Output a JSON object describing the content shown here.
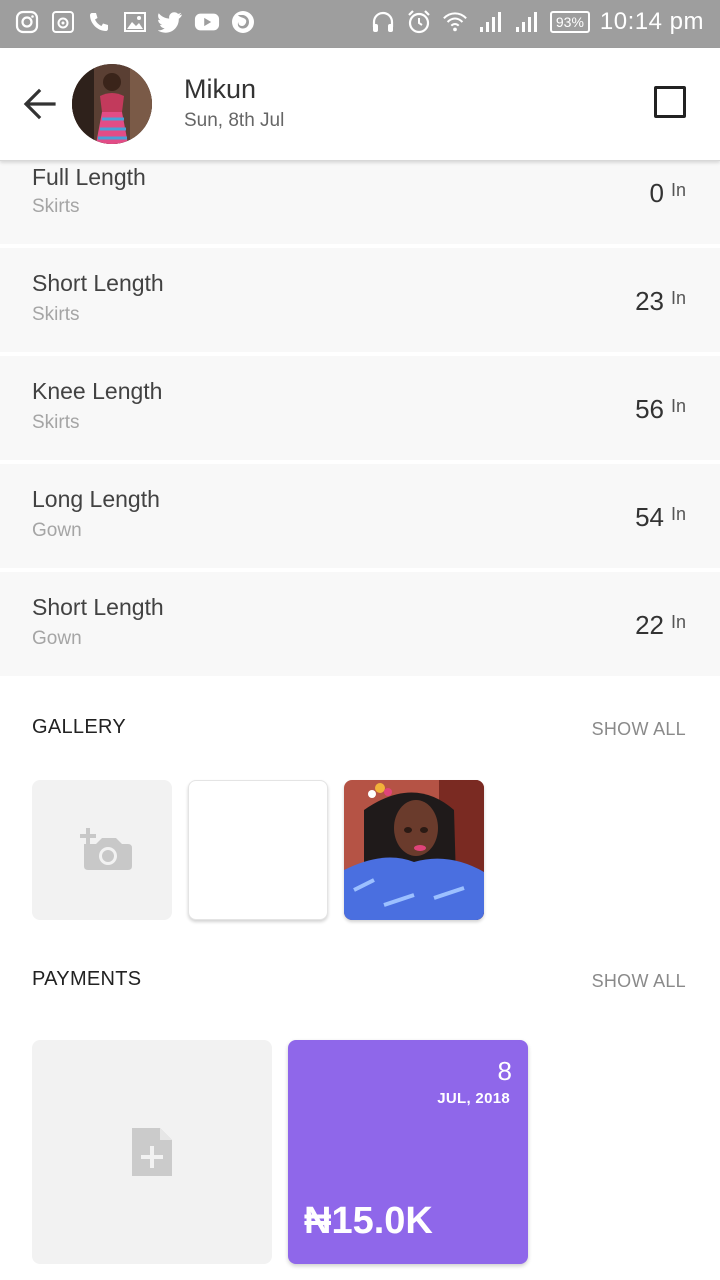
{
  "status_bar": {
    "time": "10:14 pm",
    "battery": "93%",
    "icons_left": [
      "instagram-icon",
      "camera-app-icon",
      "phone-icon",
      "gallery-icon",
      "twitter-icon",
      "youtube-icon",
      "firefox-icon"
    ],
    "icons_right": [
      "headset-icon",
      "alarm-icon",
      "wifi-icon",
      "signal-icon",
      "signal-icon"
    ]
  },
  "header": {
    "name": "Mikun",
    "date": "Sun, 8th Jul"
  },
  "measurements": [
    {
      "label": "Full Length",
      "category": "Skirts",
      "value": "0",
      "unit": "In"
    },
    {
      "label": "Short Length",
      "category": "Skirts",
      "value": "23",
      "unit": "In"
    },
    {
      "label": "Knee Length",
      "category": "Skirts",
      "value": "56",
      "unit": "In"
    },
    {
      "label": "Long Length",
      "category": "Gown",
      "value": "54",
      "unit": "In"
    },
    {
      "label": "Short Length",
      "category": "Gown",
      "value": "22",
      "unit": "In"
    }
  ],
  "gallery": {
    "title": "GALLERY",
    "show_all": "SHOW ALL"
  },
  "payments": {
    "title": "PAYMENTS",
    "show_all": "SHOW ALL",
    "items": [
      {
        "day": "8",
        "month_year": "JUL, 2018",
        "amount": "₦15.0K"
      }
    ]
  },
  "colors": {
    "status_bar": "#9e9e9e",
    "payment_card": "#8f67ea",
    "row_bg": "#f8f8f8"
  }
}
